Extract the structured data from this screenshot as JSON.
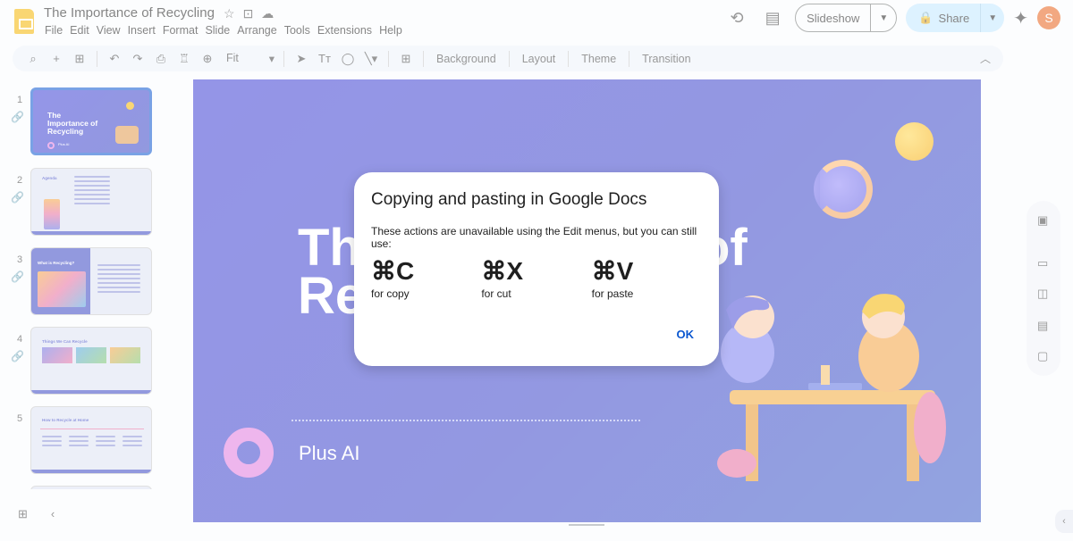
{
  "app": {
    "doc_title": "The Importance of Recycling",
    "menu": [
      "File",
      "Edit",
      "View",
      "Insert",
      "Format",
      "Slide",
      "Arrange",
      "Tools",
      "Extensions",
      "Help"
    ],
    "slideshow_label": "Slideshow",
    "share_label": "Share",
    "avatar_letter": "S"
  },
  "toolbar": {
    "zoom": "Fit",
    "background_label": "Background",
    "layout_label": "Layout",
    "theme_label": "Theme",
    "transition_label": "Transition"
  },
  "filmstrip": {
    "slides": [
      {
        "number": "1",
        "title": "The Importance of Recycling",
        "footer": "Plus AI"
      },
      {
        "number": "2",
        "heading": "Agenda"
      },
      {
        "number": "3",
        "heading": "What is Recycling?"
      },
      {
        "number": "4",
        "heading": "Things We Can Recycle"
      },
      {
        "number": "5",
        "heading": "How to Recycle at Home"
      }
    ]
  },
  "slide": {
    "title": "The Importance of Recycling",
    "footer": "Plus AI"
  },
  "dialog": {
    "title": "Copying and pasting in Google Docs",
    "description": "These actions are unavailable using the Edit menus, but you can still use:",
    "shortcuts": [
      {
        "keys": "⌘C",
        "label": "for copy"
      },
      {
        "keys": "⌘X",
        "label": "for cut"
      },
      {
        "keys": "⌘V",
        "label": "for paste"
      }
    ],
    "ok_label": "OK"
  }
}
